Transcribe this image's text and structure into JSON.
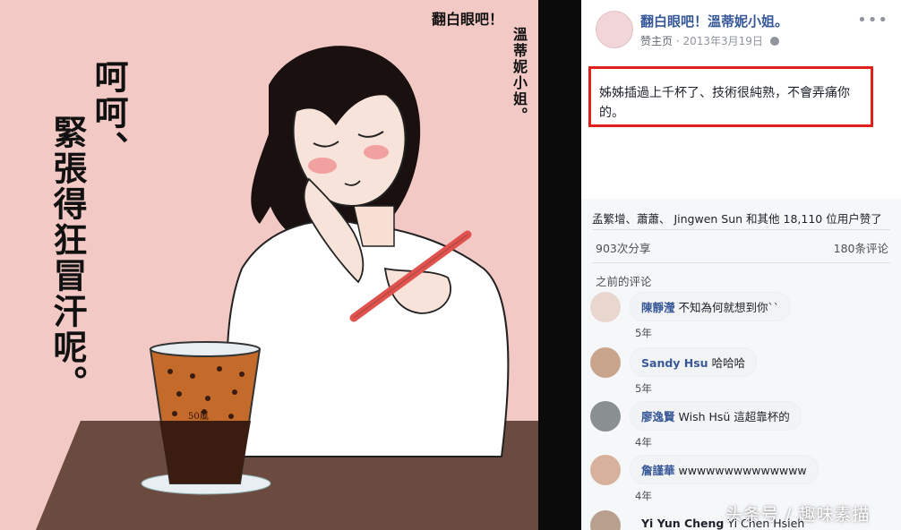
{
  "image": {
    "title_horizontal": "翻白眼吧！",
    "title_vertical": "溫蒂妮小姐。",
    "caption_lines": [
      "呵呵、",
      "緊張得狂冒汗呢。"
    ],
    "cup_label": "50嵐"
  },
  "post": {
    "page_name": "翻白眼吧！溫蒂妮小姐。",
    "sponsored": "赞主页",
    "date": "2013年3月19日",
    "more_icon": "more-dots-icon",
    "text": "姊姊插過上千杯了、技術很純熟，不會弄痛你的。",
    "likes_summary": "孟繁增、蕭蕭、 Jingwen Sun 和其他 18,110 位用户赞了",
    "shares": "903次分享",
    "comments_total": "180条评论",
    "previous_comments": "之前的评论"
  },
  "comments": [
    {
      "author": "陳靜瀅",
      "text": "不知為何就想到你``",
      "time": "5年"
    },
    {
      "author": "Sandy Hsu",
      "text": "哈哈哈",
      "time": "5年"
    },
    {
      "author": "廖逸賢",
      "text": "Wish Hsü 這超靠杯的",
      "time": "4年"
    },
    {
      "author": "詹謹華",
      "text": "wwwwwwwwwwwwww",
      "time": "4年"
    },
    {
      "author": "Yi Yun Cheng",
      "text": "Yi Chen Hsieh",
      "time": ""
    }
  ],
  "watermark": "头条号 / 趣味素描",
  "colors": {
    "accent_red": "#e0201c",
    "link_blue": "#365899",
    "image_bg": "#f3c9c6"
  }
}
